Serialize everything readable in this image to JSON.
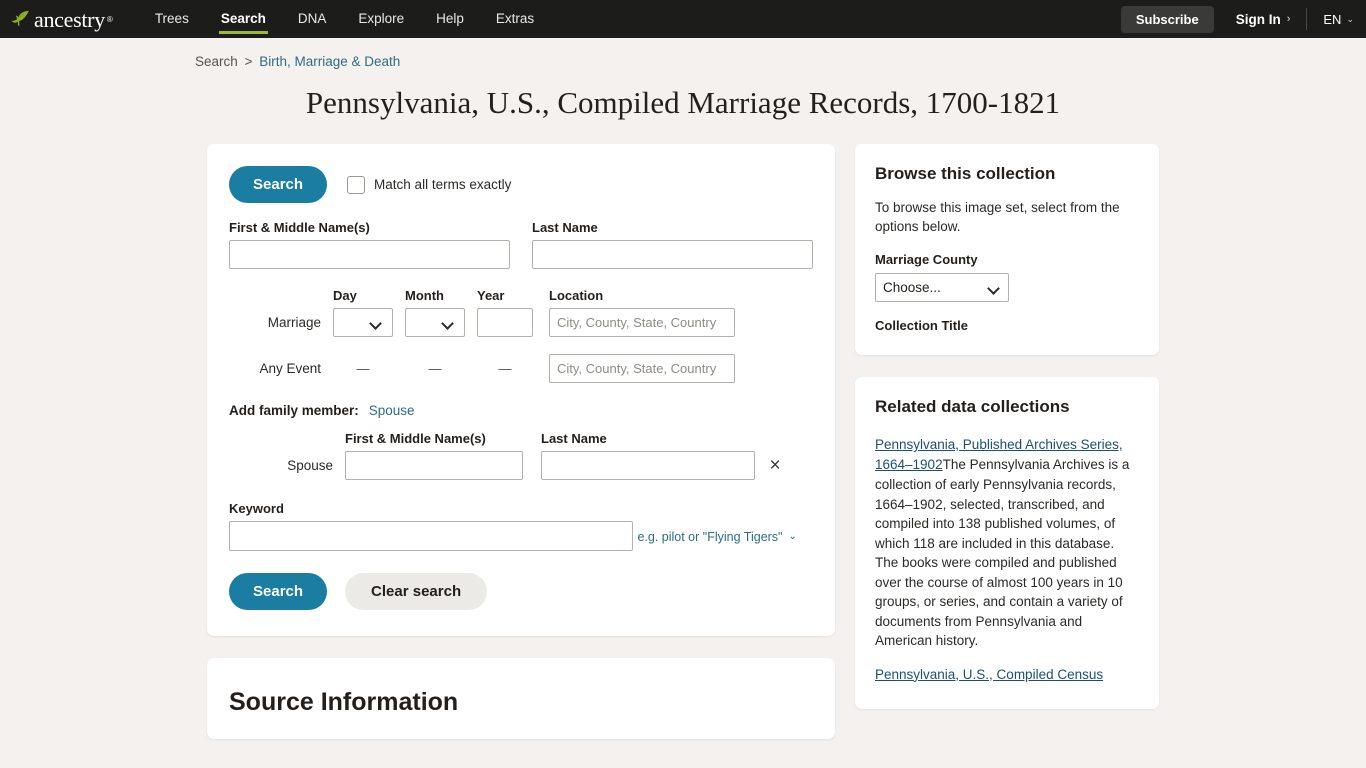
{
  "header": {
    "logo_text": "ancestry",
    "logo_icon": "leaf-icon",
    "nav": [
      {
        "label": "Trees",
        "active": false
      },
      {
        "label": "Search",
        "active": true
      },
      {
        "label": "DNA",
        "active": false
      },
      {
        "label": "Explore",
        "active": false
      },
      {
        "label": "Help",
        "active": false
      },
      {
        "label": "Extras",
        "active": false
      }
    ],
    "subscribe_label": "Subscribe",
    "signin_label": "Sign In",
    "signin_chevron": "›",
    "language": "EN",
    "language_chevron": "⌄"
  },
  "breadcrumb": {
    "root": "Search",
    "separator": ">",
    "current": "Birth, Marriage & Death"
  },
  "page_title": "Pennsylvania, U.S., Compiled Marriage Records, 1700-1821",
  "search_form": {
    "search_button_top": "Search",
    "match_exactly_label": "Match all terms exactly",
    "first_name_label": "First & Middle Name(s)",
    "first_name_value": "",
    "last_name_label": "Last Name",
    "last_name_value": "",
    "columns": {
      "day": "Day",
      "month": "Month",
      "year": "Year",
      "location": "Location"
    },
    "rows": [
      {
        "label": "Marriage",
        "day_value": "",
        "month_value": "",
        "year_value": "",
        "location_placeholder": "City, County, State, Country",
        "location_value": "",
        "has_inputs": true,
        "dash": "—"
      },
      {
        "label": "Any Event",
        "day_value": "—",
        "month_value": "—",
        "year_value": "—",
        "location_placeholder": "City, County, State, Country",
        "location_value": "",
        "has_inputs": false,
        "dash": "—"
      }
    ],
    "add_family_label": "Add family member:",
    "add_family_link": "Spouse",
    "spouse_first_header": "First & Middle Name(s)",
    "spouse_last_header": "Last Name",
    "spouse_row_label": "Spouse",
    "spouse_first_value": "",
    "spouse_last_value": "",
    "spouse_remove_icon": "×",
    "keyword_label": "Keyword",
    "keyword_value": "",
    "keyword_hint": "e.g. pilot or \"Flying Tigers\"",
    "keyword_hint_chevron": "⌄",
    "search_button_bottom": "Search",
    "clear_button": "Clear search"
  },
  "source_information": {
    "title": "Source Information"
  },
  "browse_panel": {
    "heading": "Browse this collection",
    "description": "To browse this image set, select from the options below.",
    "county_label": "Marriage County",
    "county_value": "Choose...",
    "collection_title_label": "Collection Title"
  },
  "related_panel": {
    "heading": "Related data collections",
    "items": [
      {
        "link": "Pennsylvania, Published Archives Series, 1664–1902",
        "description": "The Pennsylvania Archives is a collection of early Pennsylvania records, 1664–1902, selected, transcribed, and compiled into 138 published volumes, of which 118 are included in this database. The books were compiled and published over the course of almost 100 years in 10 groups, or series, and contain a variety of documents from Pennsylvania and American history."
      },
      {
        "link": "Pennsylvania, U.S., Compiled Census",
        "description": ""
      }
    ]
  },
  "colors": {
    "page_background": "#f4f1ee",
    "nav_background": "#1c1c1a",
    "accent_green": "#9bbb2e",
    "primary_teal": "#1a7da1",
    "link_teal": "#2c6d86",
    "link_blue": "#1c4f75",
    "card_background": "#ffffff"
  }
}
